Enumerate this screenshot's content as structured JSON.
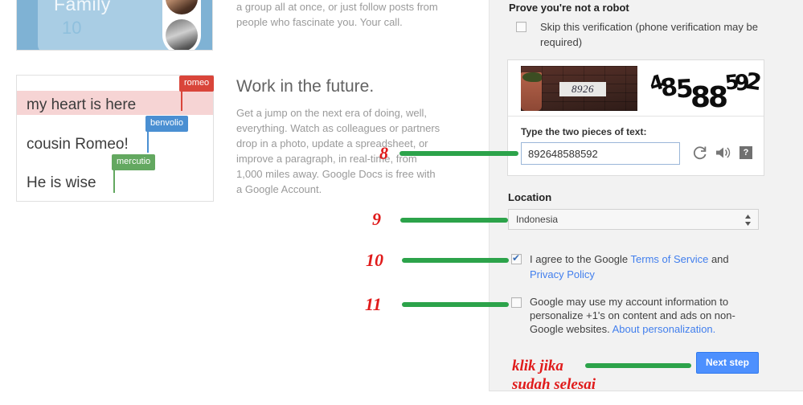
{
  "left_column": {
    "circle_image": {
      "name": "Family",
      "count": "10"
    },
    "doc_preview": {
      "lines": [
        {
          "text": "my heart is here",
          "tag": "romeo",
          "color": "#d9453a"
        },
        {
          "text": "cousin Romeo!",
          "tag": "benvolio",
          "color": "#4a8fd2"
        },
        {
          "text": "He is wise",
          "tag": "mercutio",
          "color": "#63a860"
        }
      ]
    }
  },
  "middle_column": {
    "lead_paragraph": "a group all at once, or just follow posts from people who fascinate you. Your call.",
    "heading": "Work in the future.",
    "body_paragraph": "Get a jump on the next era of doing, well, everything. Watch as colleagues or partners drop in a photo, update a spreadsheet, or improve a paragraph, in real-time, from 1,000 miles away. Google Docs is free with a Google Account."
  },
  "signup_panel": {
    "robot_heading": "Prove you're not a robot",
    "skip_verification_label": "Skip this verification (phone verification may be required)",
    "skip_verification_checked": false,
    "captcha": {
      "image_text": "8926",
      "distorted_text": "48588592",
      "prompt": "Type the two pieces of text:",
      "input_value": "892648588592",
      "input_placeholder": "",
      "refresh_icon": "refresh-icon",
      "audio_icon": "audio-icon",
      "help_icon": "help-icon",
      "help_glyph": "?"
    },
    "location": {
      "label": "Location",
      "selected": "Indonesia",
      "options": [
        "Indonesia"
      ]
    },
    "terms": {
      "text_before": "I agree to the Google ",
      "link1": "Terms of Service",
      "text_middle": " and ",
      "link2": "Privacy Policy",
      "checked": true
    },
    "personalization": {
      "text": "Google may use my account information to personalize +1's on content and ads on non-Google websites. ",
      "link": "About personalization.",
      "checked": false
    },
    "next_button": "Next step"
  },
  "annotations": {
    "numbers": [
      "8",
      "9",
      "10",
      "11"
    ],
    "note_line1": "klik jika",
    "note_line2": "sudah selesai",
    "line_color": "#2ca34a",
    "text_color": "#e01b1b"
  }
}
